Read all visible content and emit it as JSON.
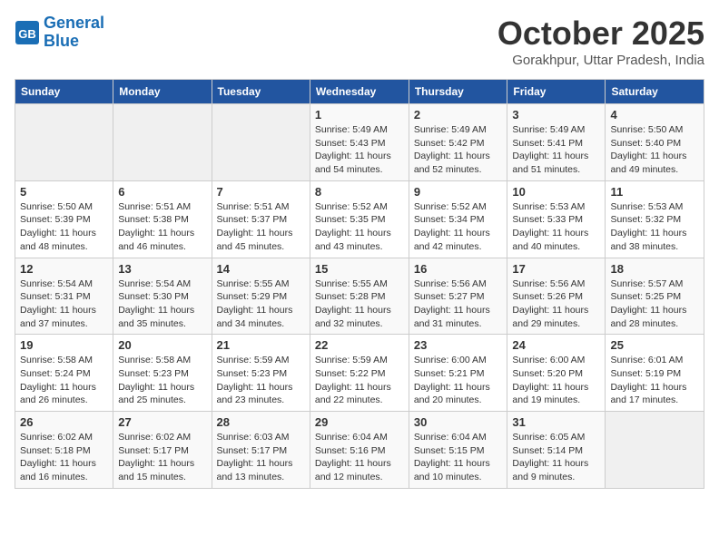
{
  "header": {
    "logo_line1": "General",
    "logo_line2": "Blue",
    "month": "October 2025",
    "location": "Gorakhpur, Uttar Pradesh, India"
  },
  "columns": [
    "Sunday",
    "Monday",
    "Tuesday",
    "Wednesday",
    "Thursday",
    "Friday",
    "Saturday"
  ],
  "weeks": [
    [
      {
        "day": "",
        "sunrise": "",
        "sunset": "",
        "daylight": ""
      },
      {
        "day": "",
        "sunrise": "",
        "sunset": "",
        "daylight": ""
      },
      {
        "day": "",
        "sunrise": "",
        "sunset": "",
        "daylight": ""
      },
      {
        "day": "1",
        "sunrise": "Sunrise: 5:49 AM",
        "sunset": "Sunset: 5:43 PM",
        "daylight": "Daylight: 11 hours and 54 minutes."
      },
      {
        "day": "2",
        "sunrise": "Sunrise: 5:49 AM",
        "sunset": "Sunset: 5:42 PM",
        "daylight": "Daylight: 11 hours and 52 minutes."
      },
      {
        "day": "3",
        "sunrise": "Sunrise: 5:49 AM",
        "sunset": "Sunset: 5:41 PM",
        "daylight": "Daylight: 11 hours and 51 minutes."
      },
      {
        "day": "4",
        "sunrise": "Sunrise: 5:50 AM",
        "sunset": "Sunset: 5:40 PM",
        "daylight": "Daylight: 11 hours and 49 minutes."
      }
    ],
    [
      {
        "day": "5",
        "sunrise": "Sunrise: 5:50 AM",
        "sunset": "Sunset: 5:39 PM",
        "daylight": "Daylight: 11 hours and 48 minutes."
      },
      {
        "day": "6",
        "sunrise": "Sunrise: 5:51 AM",
        "sunset": "Sunset: 5:38 PM",
        "daylight": "Daylight: 11 hours and 46 minutes."
      },
      {
        "day": "7",
        "sunrise": "Sunrise: 5:51 AM",
        "sunset": "Sunset: 5:37 PM",
        "daylight": "Daylight: 11 hours and 45 minutes."
      },
      {
        "day": "8",
        "sunrise": "Sunrise: 5:52 AM",
        "sunset": "Sunset: 5:35 PM",
        "daylight": "Daylight: 11 hours and 43 minutes."
      },
      {
        "day": "9",
        "sunrise": "Sunrise: 5:52 AM",
        "sunset": "Sunset: 5:34 PM",
        "daylight": "Daylight: 11 hours and 42 minutes."
      },
      {
        "day": "10",
        "sunrise": "Sunrise: 5:53 AM",
        "sunset": "Sunset: 5:33 PM",
        "daylight": "Daylight: 11 hours and 40 minutes."
      },
      {
        "day": "11",
        "sunrise": "Sunrise: 5:53 AM",
        "sunset": "Sunset: 5:32 PM",
        "daylight": "Daylight: 11 hours and 38 minutes."
      }
    ],
    [
      {
        "day": "12",
        "sunrise": "Sunrise: 5:54 AM",
        "sunset": "Sunset: 5:31 PM",
        "daylight": "Daylight: 11 hours and 37 minutes."
      },
      {
        "day": "13",
        "sunrise": "Sunrise: 5:54 AM",
        "sunset": "Sunset: 5:30 PM",
        "daylight": "Daylight: 11 hours and 35 minutes."
      },
      {
        "day": "14",
        "sunrise": "Sunrise: 5:55 AM",
        "sunset": "Sunset: 5:29 PM",
        "daylight": "Daylight: 11 hours and 34 minutes."
      },
      {
        "day": "15",
        "sunrise": "Sunrise: 5:55 AM",
        "sunset": "Sunset: 5:28 PM",
        "daylight": "Daylight: 11 hours and 32 minutes."
      },
      {
        "day": "16",
        "sunrise": "Sunrise: 5:56 AM",
        "sunset": "Sunset: 5:27 PM",
        "daylight": "Daylight: 11 hours and 31 minutes."
      },
      {
        "day": "17",
        "sunrise": "Sunrise: 5:56 AM",
        "sunset": "Sunset: 5:26 PM",
        "daylight": "Daylight: 11 hours and 29 minutes."
      },
      {
        "day": "18",
        "sunrise": "Sunrise: 5:57 AM",
        "sunset": "Sunset: 5:25 PM",
        "daylight": "Daylight: 11 hours and 28 minutes."
      }
    ],
    [
      {
        "day": "19",
        "sunrise": "Sunrise: 5:58 AM",
        "sunset": "Sunset: 5:24 PM",
        "daylight": "Daylight: 11 hours and 26 minutes."
      },
      {
        "day": "20",
        "sunrise": "Sunrise: 5:58 AM",
        "sunset": "Sunset: 5:23 PM",
        "daylight": "Daylight: 11 hours and 25 minutes."
      },
      {
        "day": "21",
        "sunrise": "Sunrise: 5:59 AM",
        "sunset": "Sunset: 5:23 PM",
        "daylight": "Daylight: 11 hours and 23 minutes."
      },
      {
        "day": "22",
        "sunrise": "Sunrise: 5:59 AM",
        "sunset": "Sunset: 5:22 PM",
        "daylight": "Daylight: 11 hours and 22 minutes."
      },
      {
        "day": "23",
        "sunrise": "Sunrise: 6:00 AM",
        "sunset": "Sunset: 5:21 PM",
        "daylight": "Daylight: 11 hours and 20 minutes."
      },
      {
        "day": "24",
        "sunrise": "Sunrise: 6:00 AM",
        "sunset": "Sunset: 5:20 PM",
        "daylight": "Daylight: 11 hours and 19 minutes."
      },
      {
        "day": "25",
        "sunrise": "Sunrise: 6:01 AM",
        "sunset": "Sunset: 5:19 PM",
        "daylight": "Daylight: 11 hours and 17 minutes."
      }
    ],
    [
      {
        "day": "26",
        "sunrise": "Sunrise: 6:02 AM",
        "sunset": "Sunset: 5:18 PM",
        "daylight": "Daylight: 11 hours and 16 minutes."
      },
      {
        "day": "27",
        "sunrise": "Sunrise: 6:02 AM",
        "sunset": "Sunset: 5:17 PM",
        "daylight": "Daylight: 11 hours and 15 minutes."
      },
      {
        "day": "28",
        "sunrise": "Sunrise: 6:03 AM",
        "sunset": "Sunset: 5:17 PM",
        "daylight": "Daylight: 11 hours and 13 minutes."
      },
      {
        "day": "29",
        "sunrise": "Sunrise: 6:04 AM",
        "sunset": "Sunset: 5:16 PM",
        "daylight": "Daylight: 11 hours and 12 minutes."
      },
      {
        "day": "30",
        "sunrise": "Sunrise: 6:04 AM",
        "sunset": "Sunset: 5:15 PM",
        "daylight": "Daylight: 11 hours and 10 minutes."
      },
      {
        "day": "31",
        "sunrise": "Sunrise: 6:05 AM",
        "sunset": "Sunset: 5:14 PM",
        "daylight": "Daylight: 11 hours and 9 minutes."
      },
      {
        "day": "",
        "sunrise": "",
        "sunset": "",
        "daylight": ""
      }
    ]
  ]
}
